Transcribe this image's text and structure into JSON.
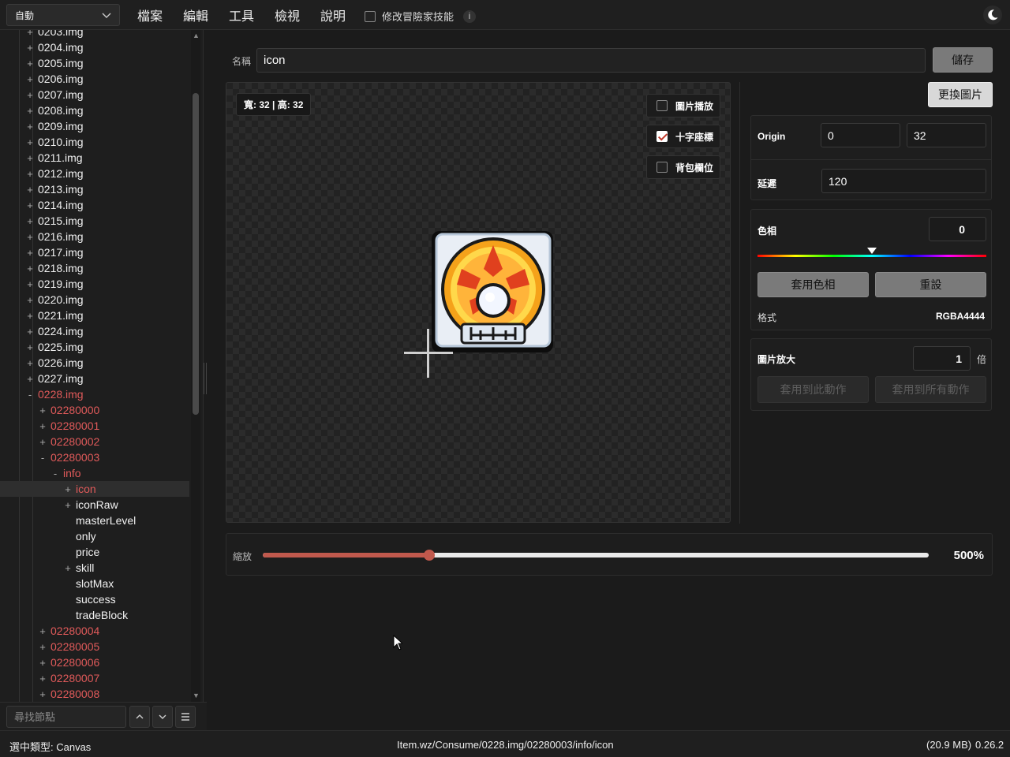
{
  "topbar": {
    "mode": "自動",
    "menu": [
      "檔案",
      "編輯",
      "工具",
      "檢視",
      "說明"
    ],
    "adventurer_toggle": "修改冒險家技能",
    "info": "i"
  },
  "tree": {
    "items": [
      {
        "sign": "+",
        "label": "0203.img",
        "depth": 0,
        "red": false
      },
      {
        "sign": "+",
        "label": "0204.img",
        "depth": 0,
        "red": false
      },
      {
        "sign": "+",
        "label": "0205.img",
        "depth": 0,
        "red": false
      },
      {
        "sign": "+",
        "label": "0206.img",
        "depth": 0,
        "red": false
      },
      {
        "sign": "+",
        "label": "0207.img",
        "depth": 0,
        "red": false
      },
      {
        "sign": "+",
        "label": "0208.img",
        "depth": 0,
        "red": false
      },
      {
        "sign": "+",
        "label": "0209.img",
        "depth": 0,
        "red": false
      },
      {
        "sign": "+",
        "label": "0210.img",
        "depth": 0,
        "red": false
      },
      {
        "sign": "+",
        "label": "0211.img",
        "depth": 0,
        "red": false
      },
      {
        "sign": "+",
        "label": "0212.img",
        "depth": 0,
        "red": false
      },
      {
        "sign": "+",
        "label": "0213.img",
        "depth": 0,
        "red": false
      },
      {
        "sign": "+",
        "label": "0214.img",
        "depth": 0,
        "red": false
      },
      {
        "sign": "+",
        "label": "0215.img",
        "depth": 0,
        "red": false
      },
      {
        "sign": "+",
        "label": "0216.img",
        "depth": 0,
        "red": false
      },
      {
        "sign": "+",
        "label": "0217.img",
        "depth": 0,
        "red": false
      },
      {
        "sign": "+",
        "label": "0218.img",
        "depth": 0,
        "red": false
      },
      {
        "sign": "+",
        "label": "0219.img",
        "depth": 0,
        "red": false
      },
      {
        "sign": "+",
        "label": "0220.img",
        "depth": 0,
        "red": false
      },
      {
        "sign": "+",
        "label": "0221.img",
        "depth": 0,
        "red": false
      },
      {
        "sign": "+",
        "label": "0224.img",
        "depth": 0,
        "red": false
      },
      {
        "sign": "+",
        "label": "0225.img",
        "depth": 0,
        "red": false
      },
      {
        "sign": "+",
        "label": "0226.img",
        "depth": 0,
        "red": false
      },
      {
        "sign": "+",
        "label": "0227.img",
        "depth": 0,
        "red": false
      },
      {
        "sign": "-",
        "label": "0228.img",
        "depth": 0,
        "red": true
      },
      {
        "sign": "+",
        "label": "02280000",
        "depth": 1,
        "red": true
      },
      {
        "sign": "+",
        "label": "02280001",
        "depth": 1,
        "red": true
      },
      {
        "sign": "+",
        "label": "02280002",
        "depth": 1,
        "red": true
      },
      {
        "sign": "-",
        "label": "02280003",
        "depth": 1,
        "red": true
      },
      {
        "sign": "-",
        "label": "info",
        "depth": 2,
        "red": true
      },
      {
        "sign": "+",
        "label": "icon",
        "depth": 3,
        "red": true,
        "selected": true
      },
      {
        "sign": "+",
        "label": "iconRaw",
        "depth": 3,
        "red": false
      },
      {
        "sign": "",
        "label": "masterLevel",
        "depth": 3,
        "red": false
      },
      {
        "sign": "",
        "label": "only",
        "depth": 3,
        "red": false
      },
      {
        "sign": "",
        "label": "price",
        "depth": 3,
        "red": false
      },
      {
        "sign": "+",
        "label": "skill",
        "depth": 3,
        "red": false
      },
      {
        "sign": "",
        "label": "slotMax",
        "depth": 3,
        "red": false
      },
      {
        "sign": "",
        "label": "success",
        "depth": 3,
        "red": false
      },
      {
        "sign": "",
        "label": "tradeBlock",
        "depth": 3,
        "red": false
      },
      {
        "sign": "+",
        "label": "02280004",
        "depth": 1,
        "red": true
      },
      {
        "sign": "+",
        "label": "02280005",
        "depth": 1,
        "red": true
      },
      {
        "sign": "+",
        "label": "02280006",
        "depth": 1,
        "red": true
      },
      {
        "sign": "+",
        "label": "02280007",
        "depth": 1,
        "red": true
      },
      {
        "sign": "+",
        "label": "02280008",
        "depth": 1,
        "red": true
      }
    ]
  },
  "search": {
    "placeholder": "尋找節點",
    "value": ""
  },
  "editor": {
    "name_label": "名稱",
    "name_value": "icon",
    "save": "儲存",
    "replace_image": "更換圖片",
    "size_tag": "寬: 32 | 高: 32",
    "overlays": [
      {
        "label": "圖片播放",
        "checked": false
      },
      {
        "label": "十字座標",
        "checked": true
      },
      {
        "label": "背包欄位",
        "checked": false
      }
    ]
  },
  "props": {
    "origin_label": "Origin",
    "origin_x": "0",
    "origin_y": "32",
    "delay_label": "延遲",
    "delay_value": "120",
    "hue_label": "色相",
    "hue_value": "0",
    "hue_fraction": 0.5,
    "apply_hue": "套用色相",
    "reset": "重設",
    "format_label": "格式",
    "format_value": "RGBA4444",
    "scale_label": "圖片放大",
    "scale_value": "1",
    "scale_unit": "倍",
    "apply_this": "套用到此動作",
    "apply_all": "套用到所有動作"
  },
  "zoom": {
    "label": "縮放",
    "value_text": "500%",
    "fraction": 0.25
  },
  "status": {
    "type": "選中類型: Canvas",
    "path": "Item.wz/Consume/0228.img/02280003/info/icon",
    "size": "(20.9 MB)",
    "version": "0.26.2"
  },
  "colors": {
    "accent": "#c0594d",
    "tree_red": "#e05a5a"
  }
}
